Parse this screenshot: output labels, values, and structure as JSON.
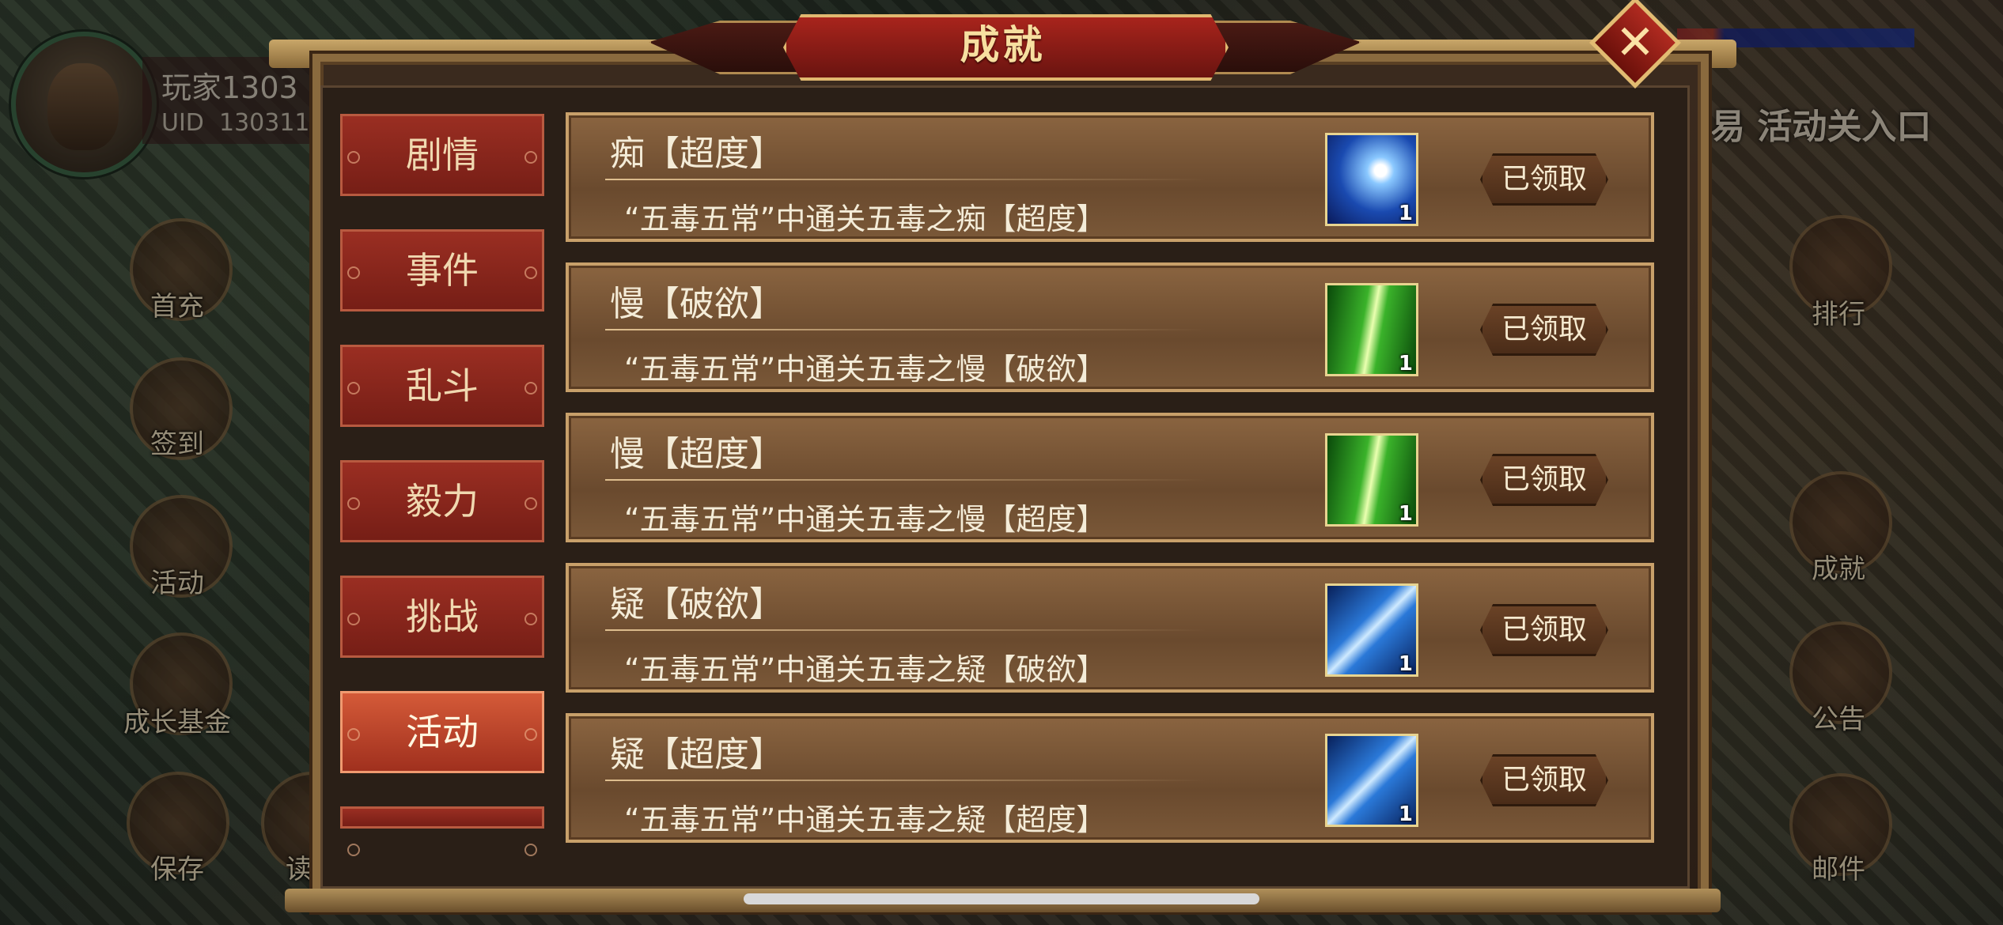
{
  "player": {
    "name": "玩家1303",
    "uid_label": "UID",
    "uid": "130311"
  },
  "left_hud": [
    {
      "label": "首充",
      "icon": "gift-icon"
    },
    {
      "label": "签到",
      "icon": "book-icon"
    },
    {
      "label": "活动",
      "icon": "scroll-icon"
    },
    {
      "label": "成长基金",
      "icon": "flower-icon"
    },
    {
      "label": "保存",
      "icon": "save-icon"
    },
    {
      "label": "读",
      "icon": "load-icon"
    }
  ],
  "right_hud": [
    {
      "label": "排行",
      "icon": "ranking-icon"
    },
    {
      "label": "成就",
      "icon": "achievement-icon"
    },
    {
      "label": "公告",
      "icon": "notice-icon"
    },
    {
      "label": "邮件",
      "icon": "mail-icon"
    }
  ],
  "right_banner": "周易 活动关入口",
  "dialog": {
    "title": "成就",
    "tabs": [
      {
        "label": "剧情",
        "active": false
      },
      {
        "label": "事件",
        "active": false
      },
      {
        "label": "乱斗",
        "active": false
      },
      {
        "label": "毅力",
        "active": false
      },
      {
        "label": "挑战",
        "active": false
      },
      {
        "label": "活动",
        "active": true
      }
    ],
    "achievements": [
      {
        "title": "痴【超度】",
        "desc": "“五毒五常”中通关五毒之痴【超度】",
        "reward_icon": "moon-slash-icon",
        "count": "1",
        "status": "已领取"
      },
      {
        "title": "慢【破欲】",
        "desc": "“五毒五常”中通关五毒之慢【破欲】",
        "reward_icon": "green-burst-icon",
        "count": "1",
        "status": "已领取"
      },
      {
        "title": "慢【超度】",
        "desc": "“五毒五常”中通关五毒之慢【超度】",
        "reward_icon": "green-burst-icon",
        "count": "1",
        "status": "已领取"
      },
      {
        "title": "疑【破欲】",
        "desc": "“五毒五常”中通关五毒之疑【破欲】",
        "reward_icon": "lightning-icon",
        "count": "1",
        "status": "已领取"
      },
      {
        "title": "疑【超度】",
        "desc": "“五毒五常”中通关五毒之疑【超度】",
        "reward_icon": "lightning-icon",
        "count": "1",
        "status": "已领取"
      }
    ]
  },
  "colors": {
    "panel_border": "#c8a06a",
    "tab_red": "#8a261c",
    "tab_active": "#c24a2c",
    "title_text": "#f7dfa0"
  }
}
